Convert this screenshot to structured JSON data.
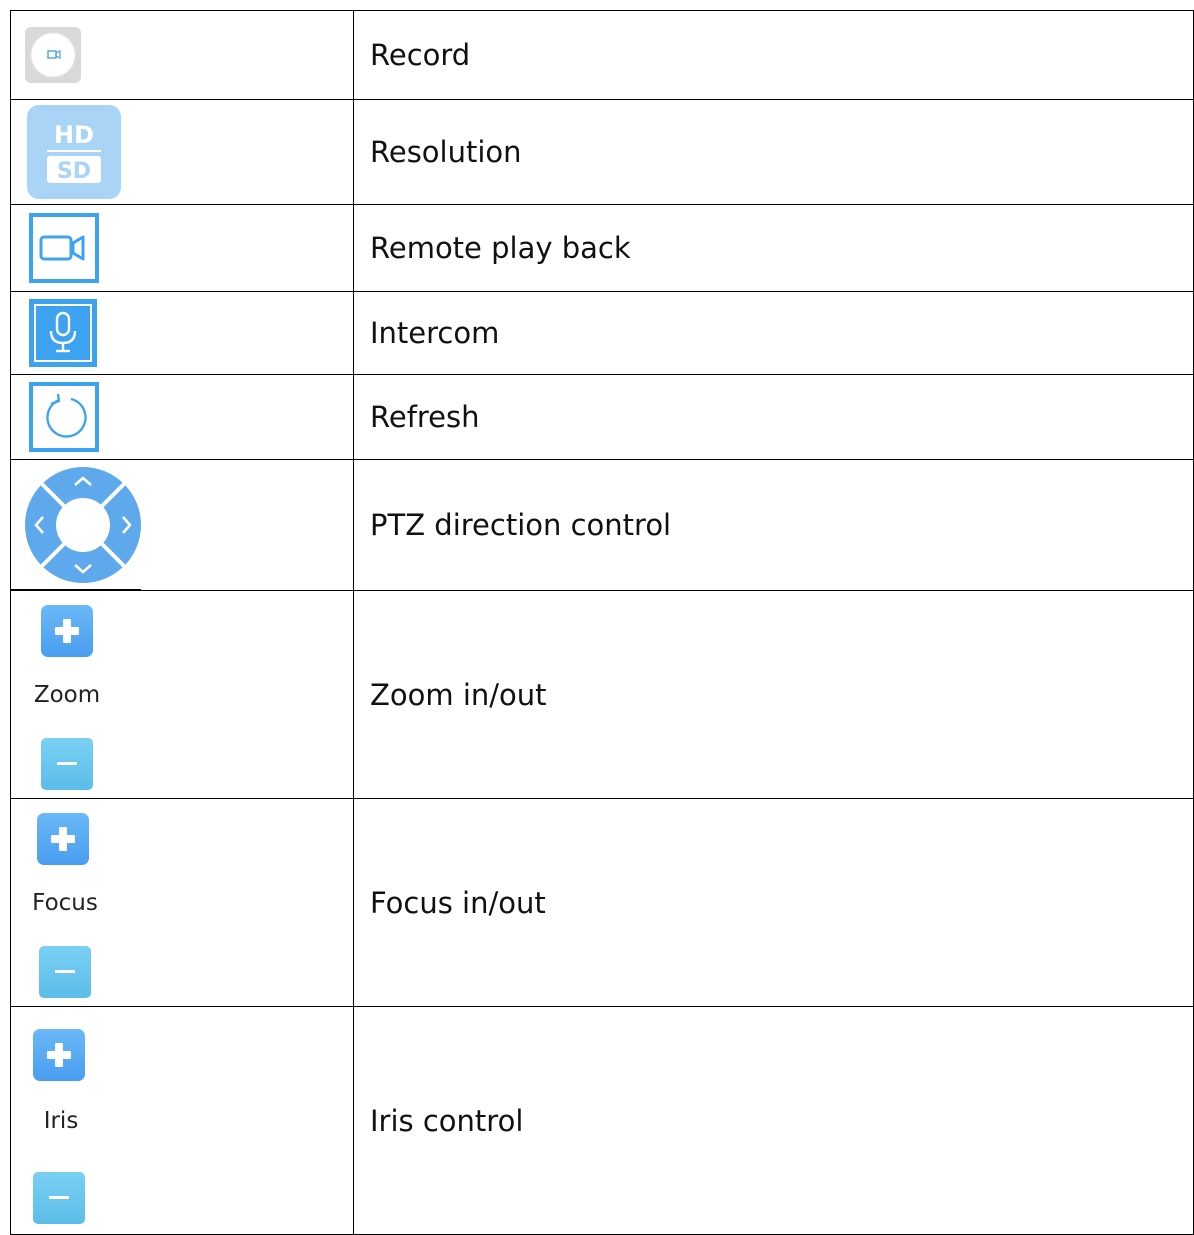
{
  "rows": [
    {
      "icon": "record-icon",
      "label": "Record"
    },
    {
      "icon": "hd-sd-icon",
      "label": "Resolution"
    },
    {
      "icon": "video-camera-icon",
      "label": "Remote play back"
    },
    {
      "icon": "microphone-icon",
      "label": "Intercom"
    },
    {
      "icon": "refresh-icon",
      "label": "Refresh"
    },
    {
      "icon": "ptz-direction-icon",
      "label": "PTZ direction control"
    },
    {
      "icon": "zoom-plus-minus-icon",
      "icon_label": "Zoom",
      "label": "Zoom in/out"
    },
    {
      "icon": "focus-plus-minus-icon",
      "icon_label": "Focus",
      "label": "Focus in/out"
    },
    {
      "icon": "iris-plus-minus-icon",
      "icon_label": "Iris",
      "label": "Iris control"
    }
  ],
  "icon_text": {
    "hd": "HD",
    "sd": "SD"
  },
  "colors": {
    "icon_blue": "#3da3f0",
    "button_blue_top": "#5aaef5",
    "button_blue_bottom": "#6ccaf0",
    "hd_sd_bg": "#a9d4f5",
    "ptz_blue": "#5ea9ec"
  }
}
